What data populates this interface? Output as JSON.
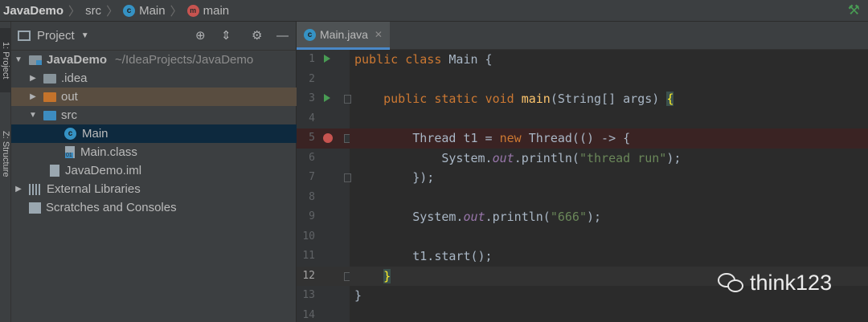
{
  "breadcrumb": {
    "project": "JavaDemo",
    "folder": "src",
    "class": "Main",
    "method": "main",
    "class_icon_letter": "c",
    "method_icon_letter": "m"
  },
  "sidebar": {
    "project_tab": "1: Project",
    "structure_tab": "Z: Structure"
  },
  "project_panel": {
    "title": "Project",
    "tree": [
      {
        "label": "JavaDemo",
        "suffix": "~/IdeaProjects/JavaDemo"
      },
      {
        "label": ".idea"
      },
      {
        "label": "out"
      },
      {
        "label": "src"
      },
      {
        "label": "Main"
      },
      {
        "label": "Main.class"
      },
      {
        "label": "JavaDemo.iml"
      },
      {
        "label": "External Libraries"
      },
      {
        "label": "Scratches and Consoles"
      }
    ]
  },
  "editor": {
    "tab_label": "Main.java",
    "line_numbers": [
      "1",
      "2",
      "3",
      "4",
      "5",
      "6",
      "7",
      "8",
      "9",
      "10",
      "11",
      "12",
      "13",
      "14"
    ],
    "code": {
      "l1_kw1": "public",
      "l1_kw2": "class",
      "l1_rest": " Main {",
      "l3_kw1": "public",
      "l3_kw2": "static",
      "l3_kw3": "void",
      "l3_fn": "main",
      "l3_rest": "(String[] args) ",
      "l3_brace": "{",
      "l5_a": "Thread t1 = ",
      "l5_kw": "new",
      "l5_b": " Thread(() -> {",
      "l6_a": "System.",
      "l6_fld": "out",
      "l6_b": ".println(",
      "l6_str": "\"thread run\"",
      "l6_c": ");",
      "l7": "});",
      "l9_a": "System.",
      "l9_fld": "out",
      "l9_b": ".println(",
      "l9_str": "\"666\"",
      "l9_c": ");",
      "l11": "t1.start();",
      "l12": "}",
      "l13": "}"
    }
  },
  "watermark": {
    "text": "think123"
  },
  "colors": {
    "keyword": "#cc7832",
    "method": "#ffc66d",
    "field": "#9876aa",
    "string": "#6a8759",
    "run_marker": "#499c54",
    "breakpoint": "#c75450"
  }
}
